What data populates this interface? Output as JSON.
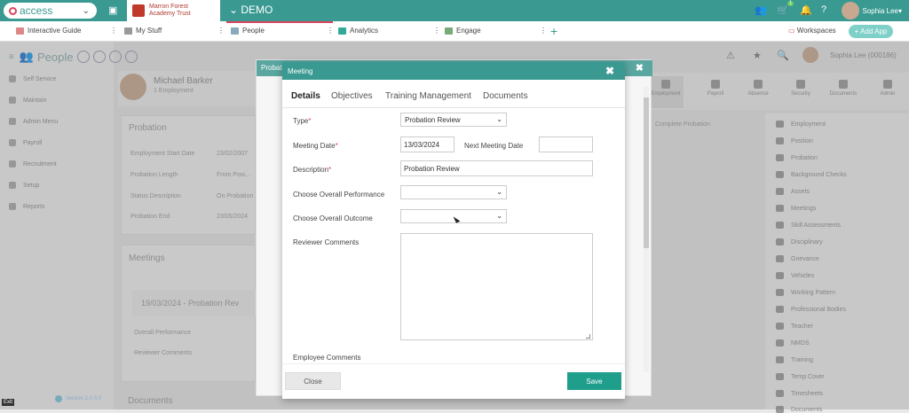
{
  "topbar": {
    "brand": "access",
    "trust_name_line1": "Marron Forest",
    "trust_name_line2": "Academy Trust",
    "environment": "DEMO",
    "user_name": "Sophia Lee",
    "notification_count": "1"
  },
  "tabs": [
    {
      "label": "Interactive Guide"
    },
    {
      "label": "My Stuff"
    },
    {
      "label": "People"
    },
    {
      "label": "Analytics"
    },
    {
      "label": "Engage"
    }
  ],
  "workspaces_label": "Workspaces",
  "add_app_label": "+ Add App",
  "background": {
    "section_title": "People",
    "employee_name": "Michael Barker",
    "employee_sub": "1 Employment",
    "user_right": "Sophia Lee (000186)",
    "sidebar": [
      "Self Service",
      "Maintain",
      "Admin Menu",
      "Payroll",
      "Recruitment",
      "Setup",
      "Reports"
    ],
    "probation_title": "Probation",
    "probation_rows": [
      {
        "label": "Employment Start Date",
        "value": "23/02/2007"
      },
      {
        "label": "Probation Length",
        "value": "From Posi..."
      },
      {
        "label": "Status Description",
        "value": "On Probation"
      },
      {
        "label": "Probation End",
        "value": "23/05/2024"
      }
    ],
    "meetings_title": "Meetings",
    "meeting_entry": "19/03/2024 - Probation Rev",
    "meeting_fields": [
      "Overall Performance",
      "Reviewer Comments"
    ],
    "documents_title": "Documents",
    "complete_probation": "Complete Probation",
    "icon_tabs": [
      "Employment",
      "Payroll",
      "Absence",
      "Security",
      "Documents",
      "Admin"
    ],
    "right_menu": [
      "Employment",
      "Position",
      "Probation",
      "Background Checks",
      "Assets",
      "Meetings",
      "Skill Assessments",
      "Disciplinary",
      "Grievance",
      "Vehicles",
      "Working Pattern",
      "Professional Bodies",
      "Teacher",
      "NMDS",
      "Training",
      "Temp Cover",
      "Timesheets",
      "Documents"
    ],
    "behind_modal_title": "Probati",
    "version": "Version 2.0.0.0",
    "exit_label": "Exit"
  },
  "modal": {
    "title": "Meeting",
    "tabs": [
      "Details",
      "Objectives",
      "Training Management",
      "Documents"
    ],
    "fields": {
      "type_label": "Type",
      "type_value": "Probation Review",
      "meeting_date_label": "Meeting Date",
      "meeting_date_value": "13/03/2024",
      "next_meeting_label": "Next Meeting Date",
      "next_meeting_value": "",
      "description_label": "Description",
      "description_value": "Probation Review",
      "overall_performance_label": "Choose Overall Performance",
      "overall_performance_value": "",
      "overall_outcome_label": "Choose Overall Outcome",
      "overall_outcome_value": "",
      "reviewer_comments_label": "Reviewer Comments",
      "reviewer_comments_value": "",
      "employee_comments_label": "Employee Comments"
    },
    "close_label": "Close",
    "save_label": "Save"
  },
  "colors": {
    "teal": "#3a9a92",
    "save_green": "#1f9e8c",
    "required_red": "#d9455f"
  }
}
